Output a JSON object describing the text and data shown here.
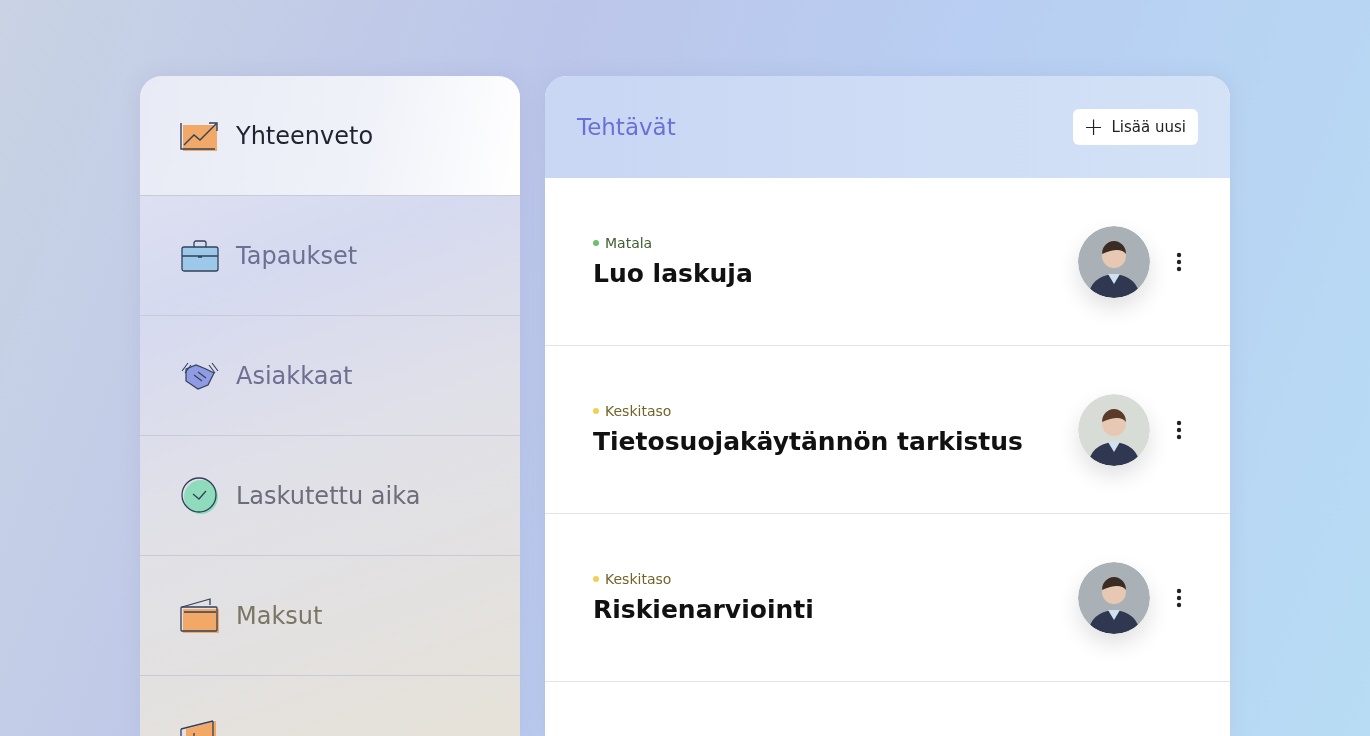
{
  "sidebar": {
    "items": [
      {
        "label": "Yhteenveto",
        "kind": "chart",
        "selected": true
      },
      {
        "label": "Tapaukset",
        "kind": "briefcase",
        "selected": false
      },
      {
        "label": "Asiakkaat",
        "kind": "handshake",
        "selected": false
      },
      {
        "label": "Laskutettu aika",
        "kind": "clock",
        "selected": false
      },
      {
        "label": "Maksut",
        "kind": "wallet",
        "selected": false
      },
      {
        "kind": "folder",
        "selected": false
      }
    ]
  },
  "tasks": {
    "title": "Tehtävät",
    "add_button": {
      "icon": "+",
      "label": "Lisää uusi"
    },
    "rows": [
      {
        "priority": "Matala",
        "color": "#6cc070",
        "name": "Luo laskuja"
      },
      {
        "priority": "Keskitaso",
        "color": "#f2cf55",
        "name": "Tietosuojakäytännön tarkistus"
      },
      {
        "priority": "Keskitaso",
        "color": "#f2cf55",
        "name": "Riskienarviointi"
      }
    ]
  }
}
